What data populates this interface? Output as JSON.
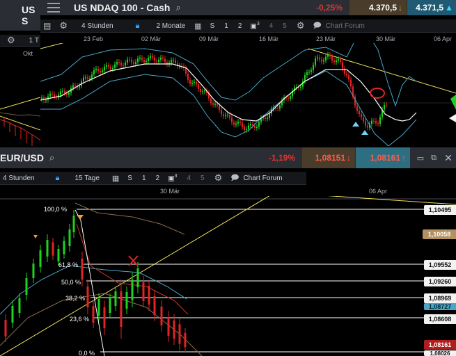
{
  "colors": {
    "negative": "#e0342f",
    "bid_box": "#5a4630",
    "ask_box": "#1f5a72",
    "ask_box_bottom": "#2d6f80",
    "current_price_tag": "#b01d1d",
    "last_close_tag": "#b29060",
    "trendline": "#f2e35a",
    "fib_line": "#ffffff",
    "bollinger": "#6f5a45",
    "bollinger_blue": "#4aa6c8",
    "candle_up": "#1ed31e",
    "candle_down": "#e02525"
  },
  "left_window": {
    "ticker_fragment": "US S",
    "toolbar_fragment": "1 T",
    "axis_fragment": "Okt"
  },
  "top_window": {
    "title": "US NDAQ 100 - Cash",
    "change_pct": "-0,25%",
    "bid": "4.370,5",
    "ask": "4.371,5",
    "toolbar": {
      "interval": "4 Stunden",
      "range": "2 Monate",
      "periods": [
        "S",
        "1",
        "2",
        "3",
        "4",
        "5"
      ],
      "chart_forum": "Chart Forum"
    },
    "dates": [
      "23 Feb",
      "02 Mär",
      "09 Mär",
      "16 Mär",
      "23 Mär",
      "30 Mär",
      "06 Apr"
    ]
  },
  "bottom_window": {
    "title": "EUR/USD",
    "change_pct": "-1,19%",
    "bid": "1,08151",
    "ask": "1,08161",
    "toolbar": {
      "interval": "4 Stunden",
      "range": "15 Tage",
      "periods": [
        "S",
        "1",
        "2",
        "3",
        "4",
        "5"
      ],
      "chart_forum": "Chart Forum"
    },
    "dates": [
      "30 Mär",
      "06 Apr"
    ],
    "fib_levels": [
      {
        "label": "100,0 %",
        "price": "1,10495"
      },
      {
        "label": "61,8 %",
        "price": "1,09552"
      },
      {
        "label": "50,0 %",
        "price": "1,09260"
      },
      {
        "label": "38,2 %",
        "price": "1,08969"
      },
      {
        "label": "23,6 %",
        "price": "1,08608"
      },
      {
        "label": "0,0 %",
        "price": "1,08026"
      }
    ],
    "tags": {
      "last_close": "1,10058",
      "bollinger_value": "1,08727",
      "current": "1,08161"
    }
  }
}
